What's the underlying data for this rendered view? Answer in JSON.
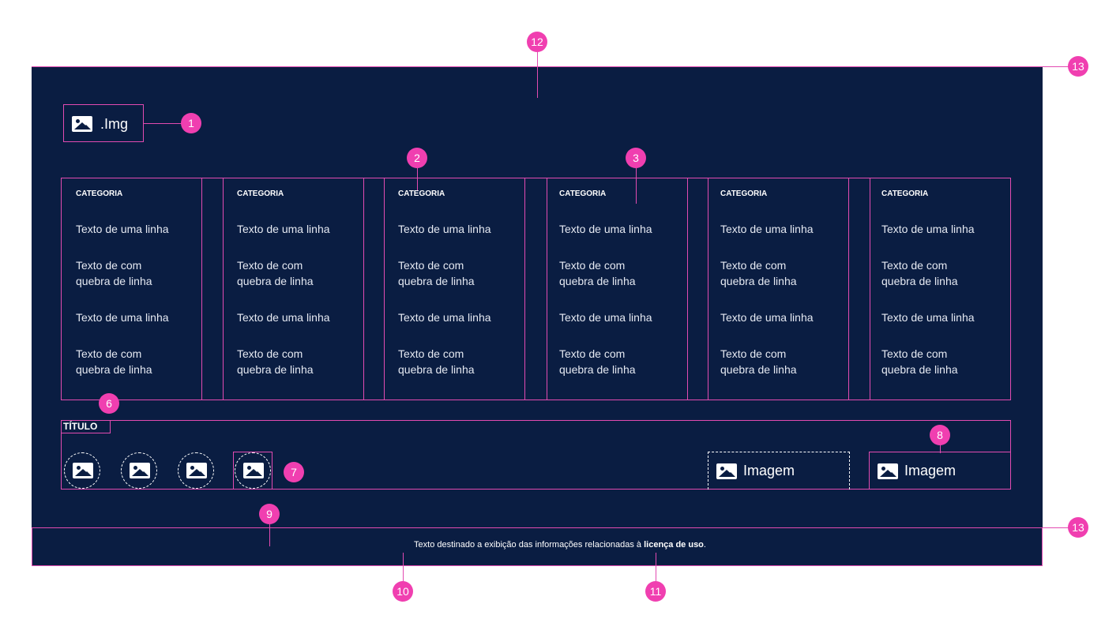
{
  "logo": {
    "label": ".Img"
  },
  "columns": [
    {
      "category": "CATEGORIA",
      "items": [
        "Texto de uma linha",
        "Texto de com\nquebra de linha",
        "Texto de uma linha",
        "Texto de com\nquebra de linha"
      ]
    },
    {
      "category": "CATEGORIA",
      "items": [
        "Texto de uma linha",
        "Texto de com\nquebra de linha",
        "Texto de uma linha",
        "Texto de com\nquebra de linha"
      ]
    },
    {
      "category": "CATEGORIA",
      "items": [
        "Texto de uma linha",
        "Texto de com\nquebra de linha",
        "Texto de uma linha",
        "Texto de com\nquebra de linha"
      ]
    },
    {
      "category": "CATEGORIA",
      "items": [
        "Texto de uma linha",
        "Texto de com\nquebra de linha",
        "Texto de uma linha",
        "Texto de com\nquebra de linha"
      ]
    },
    {
      "category": "CATEGORIA",
      "items": [
        "Texto de uma linha",
        "Texto de com\nquebra de linha",
        "Texto de uma linha",
        "Texto de com\nquebra de linha"
      ]
    },
    {
      "category": "CATEGORIA",
      "items": [
        "Texto de uma linha",
        "Texto de com\nquebra de linha",
        "Texto de uma linha",
        "Texto de com\nquebra de linha"
      ]
    }
  ],
  "social": {
    "title": "TÍTULO"
  },
  "badges": {
    "first_image_label": "Imagem",
    "second_image_label": "Imagem"
  },
  "footer": {
    "text_before": "Texto destinado a exibição das informações relacionadas à ",
    "link": "licença de uso",
    "text_after": "."
  },
  "annotations": [
    "1",
    "2",
    "3",
    "6",
    "7",
    "8",
    "9",
    "10",
    "11",
    "12",
    "13",
    "13"
  ],
  "colors": {
    "panel": "#0a1d42",
    "accent": "#f03fb0",
    "outline": "#e24bb1"
  }
}
